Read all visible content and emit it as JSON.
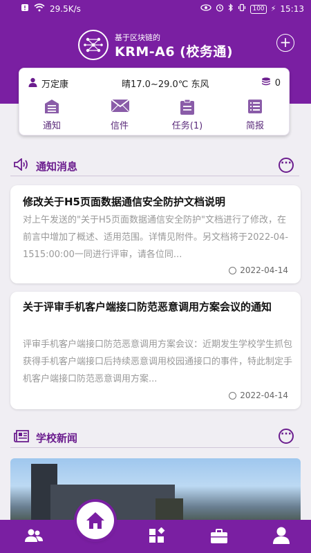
{
  "status_bar": {
    "net_speed": "29.5K/s",
    "battery": "100",
    "time": "15:13"
  },
  "header": {
    "brand_subtitle": "基于区块链的",
    "brand_title": "KRM-A6 (校务通)"
  },
  "info_card": {
    "user_name": "万定康",
    "weather": "晴17.0~29.0℃ 东风",
    "coins": "0",
    "quick_links": [
      {
        "label": "通知"
      },
      {
        "label": "信件"
      },
      {
        "label": "任务(1)"
      },
      {
        "label": "简报"
      }
    ]
  },
  "notices_section": {
    "title": "通知消息",
    "items": [
      {
        "title": "修改关于H5页面数据通信安全防护文档说明",
        "body": "对上午发送的\"关于H5页面数据通信安全防护\"文档进行了修改，在前言中增加了概述、适用范围。详情见附件。另文档将于2022-04-1515:00:00一同进行评审，请各位同...",
        "date": "2022-04-14"
      },
      {
        "title": "关于评审手机客户端接口防范恶意调用方案会议的通知",
        "body": "评审手机客户端接口防范恶意调用方案会议：近期发生学校学生抓包获得手机客户端接口后持续恶意调用校园通接口的事件，特此制定手机客户端接口防范恶意调用方案...",
        "date": "2022-04-14"
      }
    ]
  },
  "news_section": {
    "title": "学校新闻"
  },
  "colors": {
    "primary": "#7a1fa2",
    "accent_text": "#6b1d8e"
  },
  "tabbar": {
    "items": [
      "contacts-icon",
      "home-icon",
      "apps-icon",
      "briefcase-icon",
      "profile-icon"
    ]
  }
}
